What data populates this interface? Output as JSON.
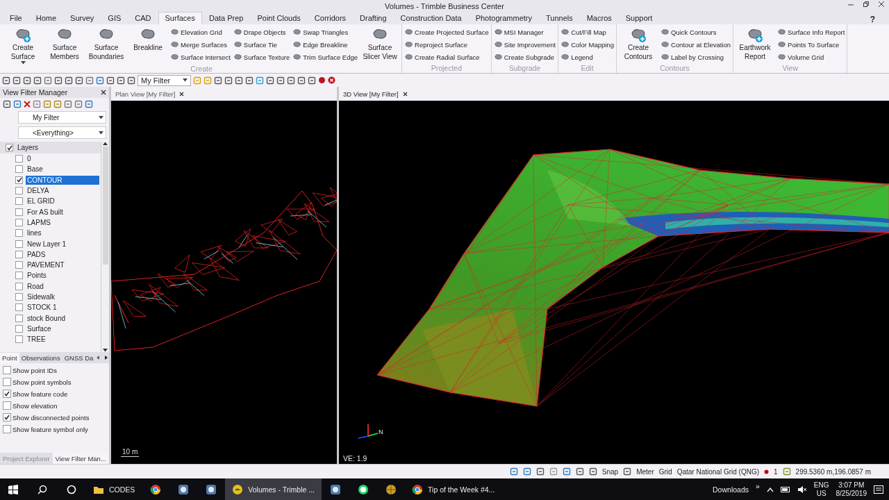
{
  "window": {
    "title": "Volumes - Trimble Business Center"
  },
  "menu_tabs": [
    {
      "label": "File",
      "selected": false
    },
    {
      "label": "Home",
      "selected": false
    },
    {
      "label": "Survey",
      "selected": false
    },
    {
      "label": "GIS",
      "selected": false
    },
    {
      "label": "CAD",
      "selected": false
    },
    {
      "label": "Surfaces",
      "selected": true
    },
    {
      "label": "Data Prep",
      "selected": false
    },
    {
      "label": "Point Clouds",
      "selected": false
    },
    {
      "label": "Corridors",
      "selected": false
    },
    {
      "label": "Drafting",
      "selected": false
    },
    {
      "label": "Construction Data",
      "selected": false
    },
    {
      "label": "Photogrammetry",
      "selected": false
    },
    {
      "label": "Tunnels",
      "selected": false
    },
    {
      "label": "Macros",
      "selected": false
    },
    {
      "label": "Support",
      "selected": false
    }
  ],
  "help": "?",
  "ribbon": [
    {
      "label": "Create",
      "items": [
        {
          "kind": "large",
          "label": "Create Surface",
          "dropdown": true
        },
        {
          "kind": "large",
          "label": "Surface Members"
        },
        {
          "kind": "large",
          "label": "Surface Boundaries"
        },
        {
          "kind": "large",
          "label": "Breakline"
        },
        {
          "kind": "small",
          "label": "Elevation Grid"
        },
        {
          "kind": "small",
          "label": "Merge Surfaces"
        },
        {
          "kind": "small",
          "label": "Surface Intersect"
        },
        {
          "kind": "small",
          "label": "Drape Objects"
        },
        {
          "kind": "small",
          "label": "Surface Tie"
        },
        {
          "kind": "small",
          "label": "Surface Texture"
        },
        {
          "kind": "small",
          "label": "Swap Triangles"
        },
        {
          "kind": "small",
          "label": "Edge Breakline"
        },
        {
          "kind": "small",
          "label": "Trim Surface Edge"
        },
        {
          "kind": "large",
          "label": "Surface Slicer View"
        }
      ]
    },
    {
      "label": "Projected",
      "items": [
        {
          "kind": "small",
          "label": "Create Projected Surface"
        },
        {
          "kind": "small",
          "label": "Reproject Surface"
        },
        {
          "kind": "small",
          "label": "Create Radial Surface"
        }
      ]
    },
    {
      "label": "Subgrade",
      "items": [
        {
          "kind": "small",
          "label": "MSI Manager"
        },
        {
          "kind": "small",
          "label": "Site Improvement"
        },
        {
          "kind": "small",
          "label": "Create Subgrade"
        }
      ]
    },
    {
      "label": "Edit",
      "items": [
        {
          "kind": "small",
          "label": "Cut/Fill Map"
        },
        {
          "kind": "small",
          "label": "Color Mapping"
        },
        {
          "kind": "small",
          "label": "Legend"
        }
      ]
    },
    {
      "label": "Contours",
      "items": [
        {
          "kind": "large",
          "label": "Create Contours"
        },
        {
          "kind": "small",
          "label": "Quick Contours"
        },
        {
          "kind": "small",
          "label": "Contour at Elevation"
        },
        {
          "kind": "small",
          "label": "Label by Crossing"
        }
      ]
    },
    {
      "label": "View",
      "items": [
        {
          "kind": "large",
          "label": "Earthwork Report"
        },
        {
          "kind": "small",
          "label": "Surface Info Report"
        },
        {
          "kind": "small",
          "label": "Points To Surface"
        },
        {
          "kind": "small",
          "label": "Volume Grid"
        }
      ]
    }
  ],
  "toolbar": {
    "filter": "My Filter"
  },
  "filter_manager": {
    "title": "View Filter Manager",
    "filter": "My Filter",
    "scope": "<Everything>",
    "tree": {
      "label": "Layers",
      "checked": true,
      "children": [
        {
          "label": "0",
          "checked": false,
          "selected": false
        },
        {
          "label": "Base",
          "checked": false,
          "selected": false
        },
        {
          "label": "CONTOUR",
          "checked": true,
          "selected": true
        },
        {
          "label": "DELYA",
          "checked": false,
          "selected": false
        },
        {
          "label": "EL GRID",
          "checked": false,
          "selected": false
        },
        {
          "label": "For AS built",
          "checked": false,
          "selected": false
        },
        {
          "label": "LAPMS",
          "checked": false,
          "selected": false
        },
        {
          "label": "lines",
          "checked": false,
          "selected": false
        },
        {
          "label": "New Layer 1",
          "checked": false,
          "selected": false
        },
        {
          "label": "PADS",
          "checked": false,
          "selected": false
        },
        {
          "label": "PAVEMENT",
          "checked": false,
          "selected": false
        },
        {
          "label": "Points",
          "checked": false,
          "selected": false
        },
        {
          "label": "Road",
          "checked": false,
          "selected": false
        },
        {
          "label": "Sidewalk",
          "checked": false,
          "selected": false
        },
        {
          "label": "STOCK 1",
          "checked": false,
          "selected": false
        },
        {
          "label": "stock Bound",
          "checked": false,
          "selected": false
        },
        {
          "label": "Surface",
          "checked": false,
          "selected": false
        },
        {
          "label": "TREE",
          "checked": false,
          "selected": false
        }
      ]
    },
    "tabs": [
      {
        "label": "Point",
        "selected": true
      },
      {
        "label": "Observations",
        "selected": false
      },
      {
        "label": "GNSS Da",
        "selected": false
      }
    ],
    "options": [
      {
        "label": "Show point IDs",
        "checked": false
      },
      {
        "label": "Show point symbols",
        "checked": false
      },
      {
        "label": "Show feature code",
        "checked": true
      },
      {
        "label": "Show elevation",
        "checked": false
      },
      {
        "label": "Show disconnected points",
        "checked": true
      },
      {
        "label": "Show feature symbol only",
        "checked": false
      }
    ]
  },
  "panel_tabs": [
    {
      "label": "Project Explorer",
      "selected": false
    },
    {
      "label": "View Filter Man...",
      "selected": true
    }
  ],
  "plan_view": {
    "tab": "Plan View [My Filter]",
    "scale": "10 m"
  },
  "view_3d": {
    "tab": "3D View [My Filter]",
    "axis_label": "N",
    "ve": "VE: 1.9"
  },
  "status_bar": {
    "snap": "Snap",
    "units": "Meter",
    "grid": "Grid",
    "projection": "Qatar National Grid (QNG)",
    "count": "1",
    "coordinates": "299.5360 m,196.0857 m"
  },
  "taskbar": {
    "apps": [
      {
        "kind": "folder",
        "label": "CODES",
        "selected": false
      },
      {
        "kind": "browser",
        "selected": false
      },
      {
        "kind": "app",
        "selected": false
      },
      {
        "kind": "app",
        "selected": false
      },
      {
        "kind": "window",
        "label": "Volumes - Trimble ...",
        "selected": true
      },
      {
        "kind": "app",
        "selected": false
      },
      {
        "kind": "chat",
        "selected": false
      },
      {
        "kind": "globe",
        "selected": false
      },
      {
        "kind": "browser",
        "label": "Tip of the Week #4...",
        "selected": false
      }
    ],
    "downloads": "Downloads",
    "overflow": "»",
    "lang": "ENG",
    "region": "US",
    "time": "3:07 PM",
    "date": "8/25/2019"
  }
}
